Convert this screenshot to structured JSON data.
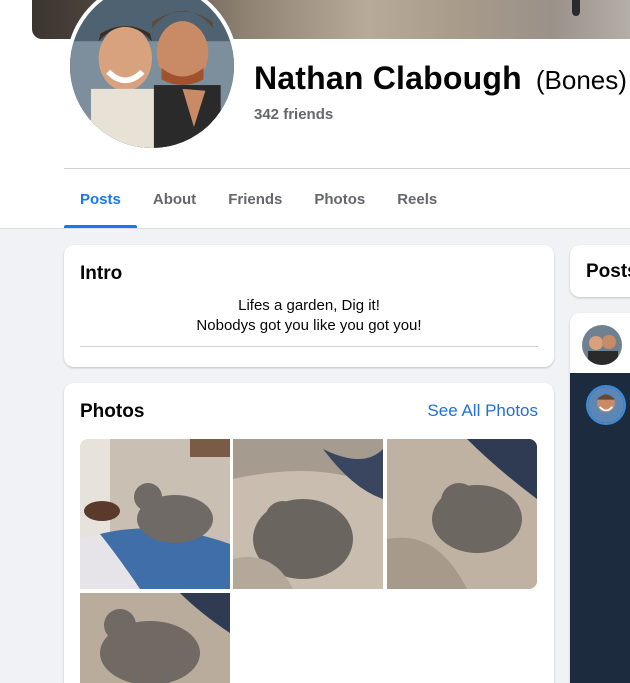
{
  "profile": {
    "name": "Nathan Clabough",
    "nickname": "(Bones)",
    "friends": "342 friends"
  },
  "tabs": [
    {
      "label": "Posts",
      "active": true
    },
    {
      "label": "About",
      "active": false
    },
    {
      "label": "Friends",
      "active": false
    },
    {
      "label": "Photos",
      "active": false
    },
    {
      "label": "Reels",
      "active": false
    }
  ],
  "intro": {
    "title": "Intro",
    "bio_line1": "Lifes a garden, Dig it!",
    "bio_line2": "Nobodys got you like you got you!"
  },
  "photos": {
    "title": "Photos",
    "see_all": "See All Photos"
  },
  "posts": {
    "title": "Posts"
  },
  "colors": {
    "accent": "#1877f2",
    "link": "#216fdb",
    "background": "#f0f2f5"
  }
}
